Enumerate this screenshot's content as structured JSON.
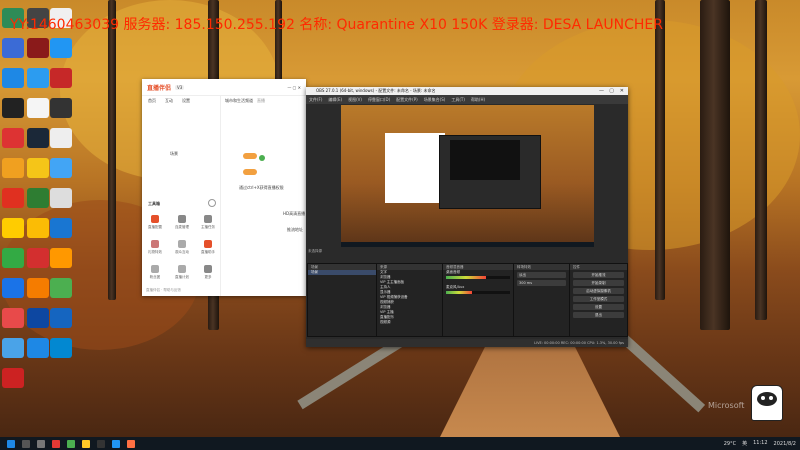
{
  "overlay": {
    "text": "YY:1460463039  服务器: 185.150.255.192  名称: Quarantine X10 150K  登录器: DESA LAUNCHER"
  },
  "desktop": {
    "watermark": "Microsoft"
  },
  "app_window": {
    "logo": "直播伴侣",
    "version": "V3",
    "tabs": [
      "首页",
      "互动",
      "设置"
    ],
    "toolbar_label": "场景",
    "main_title": "城市和生活频道",
    "main_tag": "直播",
    "section_label": "工具箱",
    "tiles": [
      {
        "label": "直播配置"
      },
      {
        "label": "连麦管理"
      },
      {
        "label": "主播任务"
      },
      {
        "label": "礼物特效"
      },
      {
        "label": "观众互动"
      },
      {
        "label": "直播助手"
      },
      {
        "label": "粉丝团"
      },
      {
        "label": "直播计划"
      },
      {
        "label": "更多"
      }
    ],
    "center_hint": "通过ctrl+X获得直播权限",
    "side_text_1": "HD高清直播",
    "side_text_2": "推流地址",
    "footer": "直播伴侣  ·  帮助与反馈"
  },
  "obs_window": {
    "title": "OBS 27.0.1 (64-bit, windows) - 配置文件: 未命名 - 场景: 未命名",
    "menus": [
      "文件(F)",
      "编辑(E)",
      "视图(V)",
      "停靠窗口(D)",
      "配置文件(P)",
      "场景集合(S)",
      "工具(T)",
      "帮助(H)"
    ],
    "scene_label": "未选择源",
    "panels": {
      "scenes": {
        "title": "场景",
        "items": [
          "场景"
        ]
      },
      "sources": {
        "title": "来源",
        "items": [
          "文字",
          "浏览器",
          "VIP 主主播面板",
          "主持人",
          "显示器",
          "VIP 视频捕获设备",
          "视频捕获",
          "浏览器",
          "VIP 主播",
          "直播配乐",
          "视频源"
        ]
      },
      "mixer": {
        "title": "音频混音器",
        "items": [
          "桌面音频",
          "麦克风/Aux"
        ],
        "levels": [
          0.62,
          0.4
        ]
      },
      "transitions": {
        "title": "转场特效",
        "mode": "淡出",
        "duration": "300 ms"
      },
      "controls": {
        "title": "控件",
        "buttons": [
          "开始推流",
          "开始录制",
          "启动虚拟摄像机",
          "工作室模式",
          "设置",
          "退出"
        ]
      }
    },
    "status": "LIVE: 00:00:00   REC: 00:00:00   CPU: 1.3%, 30.00 fps"
  },
  "taskbar": {
    "tray_time": "11:12",
    "tray_date": "2021/8/2",
    "tray_lang": "英",
    "tray_temp": "29°C"
  },
  "colors": {
    "overlay_text": "#ff2a00",
    "obs_bg": "#2a2a2a",
    "taskbar": "#101820",
    "accent": "#e5502a"
  }
}
